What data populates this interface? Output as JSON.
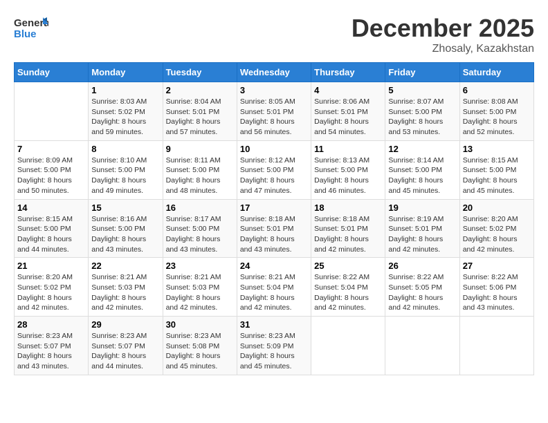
{
  "header": {
    "logo_general": "General",
    "logo_blue": "Blue",
    "month": "December 2025",
    "location": "Zhosaly, Kazakhstan"
  },
  "days_of_week": [
    "Sunday",
    "Monday",
    "Tuesday",
    "Wednesday",
    "Thursday",
    "Friday",
    "Saturday"
  ],
  "weeks": [
    [
      {
        "day": "",
        "sunrise": "",
        "sunset": "",
        "daylight": ""
      },
      {
        "day": "1",
        "sunrise": "Sunrise: 8:03 AM",
        "sunset": "Sunset: 5:02 PM",
        "daylight": "Daylight: 8 hours and 59 minutes."
      },
      {
        "day": "2",
        "sunrise": "Sunrise: 8:04 AM",
        "sunset": "Sunset: 5:01 PM",
        "daylight": "Daylight: 8 hours and 57 minutes."
      },
      {
        "day": "3",
        "sunrise": "Sunrise: 8:05 AM",
        "sunset": "Sunset: 5:01 PM",
        "daylight": "Daylight: 8 hours and 56 minutes."
      },
      {
        "day": "4",
        "sunrise": "Sunrise: 8:06 AM",
        "sunset": "Sunset: 5:01 PM",
        "daylight": "Daylight: 8 hours and 54 minutes."
      },
      {
        "day": "5",
        "sunrise": "Sunrise: 8:07 AM",
        "sunset": "Sunset: 5:00 PM",
        "daylight": "Daylight: 8 hours and 53 minutes."
      },
      {
        "day": "6",
        "sunrise": "Sunrise: 8:08 AM",
        "sunset": "Sunset: 5:00 PM",
        "daylight": "Daylight: 8 hours and 52 minutes."
      }
    ],
    [
      {
        "day": "7",
        "sunrise": "Sunrise: 8:09 AM",
        "sunset": "Sunset: 5:00 PM",
        "daylight": "Daylight: 8 hours and 50 minutes."
      },
      {
        "day": "8",
        "sunrise": "Sunrise: 8:10 AM",
        "sunset": "Sunset: 5:00 PM",
        "daylight": "Daylight: 8 hours and 49 minutes."
      },
      {
        "day": "9",
        "sunrise": "Sunrise: 8:11 AM",
        "sunset": "Sunset: 5:00 PM",
        "daylight": "Daylight: 8 hours and 48 minutes."
      },
      {
        "day": "10",
        "sunrise": "Sunrise: 8:12 AM",
        "sunset": "Sunset: 5:00 PM",
        "daylight": "Daylight: 8 hours and 47 minutes."
      },
      {
        "day": "11",
        "sunrise": "Sunrise: 8:13 AM",
        "sunset": "Sunset: 5:00 PM",
        "daylight": "Daylight: 8 hours and 46 minutes."
      },
      {
        "day": "12",
        "sunrise": "Sunrise: 8:14 AM",
        "sunset": "Sunset: 5:00 PM",
        "daylight": "Daylight: 8 hours and 45 minutes."
      },
      {
        "day": "13",
        "sunrise": "Sunrise: 8:15 AM",
        "sunset": "Sunset: 5:00 PM",
        "daylight": "Daylight: 8 hours and 45 minutes."
      }
    ],
    [
      {
        "day": "14",
        "sunrise": "Sunrise: 8:15 AM",
        "sunset": "Sunset: 5:00 PM",
        "daylight": "Daylight: 8 hours and 44 minutes."
      },
      {
        "day": "15",
        "sunrise": "Sunrise: 8:16 AM",
        "sunset": "Sunset: 5:00 PM",
        "daylight": "Daylight: 8 hours and 43 minutes."
      },
      {
        "day": "16",
        "sunrise": "Sunrise: 8:17 AM",
        "sunset": "Sunset: 5:00 PM",
        "daylight": "Daylight: 8 hours and 43 minutes."
      },
      {
        "day": "17",
        "sunrise": "Sunrise: 8:18 AM",
        "sunset": "Sunset: 5:01 PM",
        "daylight": "Daylight: 8 hours and 43 minutes."
      },
      {
        "day": "18",
        "sunrise": "Sunrise: 8:18 AM",
        "sunset": "Sunset: 5:01 PM",
        "daylight": "Daylight: 8 hours and 42 minutes."
      },
      {
        "day": "19",
        "sunrise": "Sunrise: 8:19 AM",
        "sunset": "Sunset: 5:01 PM",
        "daylight": "Daylight: 8 hours and 42 minutes."
      },
      {
        "day": "20",
        "sunrise": "Sunrise: 8:20 AM",
        "sunset": "Sunset: 5:02 PM",
        "daylight": "Daylight: 8 hours and 42 minutes."
      }
    ],
    [
      {
        "day": "21",
        "sunrise": "Sunrise: 8:20 AM",
        "sunset": "Sunset: 5:02 PM",
        "daylight": "Daylight: 8 hours and 42 minutes."
      },
      {
        "day": "22",
        "sunrise": "Sunrise: 8:21 AM",
        "sunset": "Sunset: 5:03 PM",
        "daylight": "Daylight: 8 hours and 42 minutes."
      },
      {
        "day": "23",
        "sunrise": "Sunrise: 8:21 AM",
        "sunset": "Sunset: 5:03 PM",
        "daylight": "Daylight: 8 hours and 42 minutes."
      },
      {
        "day": "24",
        "sunrise": "Sunrise: 8:21 AM",
        "sunset": "Sunset: 5:04 PM",
        "daylight": "Daylight: 8 hours and 42 minutes."
      },
      {
        "day": "25",
        "sunrise": "Sunrise: 8:22 AM",
        "sunset": "Sunset: 5:04 PM",
        "daylight": "Daylight: 8 hours and 42 minutes."
      },
      {
        "day": "26",
        "sunrise": "Sunrise: 8:22 AM",
        "sunset": "Sunset: 5:05 PM",
        "daylight": "Daylight: 8 hours and 42 minutes."
      },
      {
        "day": "27",
        "sunrise": "Sunrise: 8:22 AM",
        "sunset": "Sunset: 5:06 PM",
        "daylight": "Daylight: 8 hours and 43 minutes."
      }
    ],
    [
      {
        "day": "28",
        "sunrise": "Sunrise: 8:23 AM",
        "sunset": "Sunset: 5:07 PM",
        "daylight": "Daylight: 8 hours and 43 minutes."
      },
      {
        "day": "29",
        "sunrise": "Sunrise: 8:23 AM",
        "sunset": "Sunset: 5:07 PM",
        "daylight": "Daylight: 8 hours and 44 minutes."
      },
      {
        "day": "30",
        "sunrise": "Sunrise: 8:23 AM",
        "sunset": "Sunset: 5:08 PM",
        "daylight": "Daylight: 8 hours and 45 minutes."
      },
      {
        "day": "31",
        "sunrise": "Sunrise: 8:23 AM",
        "sunset": "Sunset: 5:09 PM",
        "daylight": "Daylight: 8 hours and 45 minutes."
      },
      {
        "day": "",
        "sunrise": "",
        "sunset": "",
        "daylight": ""
      },
      {
        "day": "",
        "sunrise": "",
        "sunset": "",
        "daylight": ""
      },
      {
        "day": "",
        "sunrise": "",
        "sunset": "",
        "daylight": ""
      }
    ]
  ]
}
